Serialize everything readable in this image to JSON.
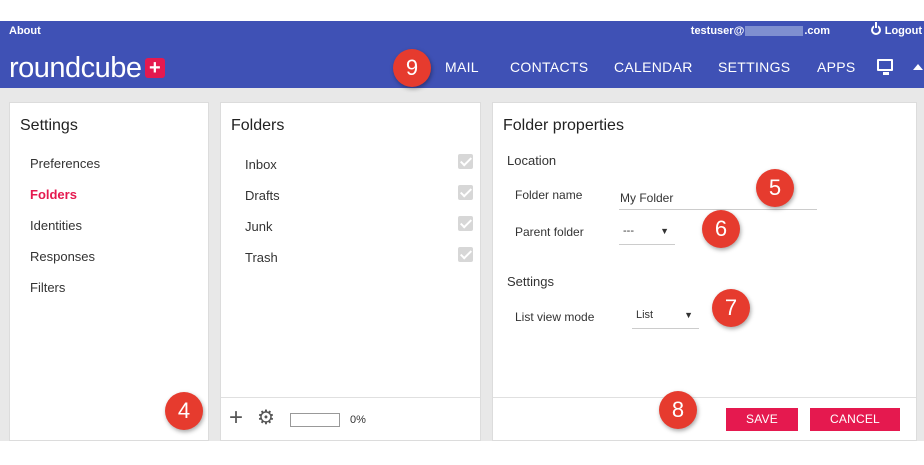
{
  "header": {
    "about": "About",
    "user_prefix": "testuser@",
    "user_suffix": ".com",
    "logout": "Logout",
    "logo": "roundcube",
    "logo_plus": "+",
    "nav": {
      "mail": "MAIL",
      "contacts": "CONTACTS",
      "calendar": "CALENDAR",
      "settings": "SETTINGS",
      "apps": "APPS"
    },
    "icons": {
      "display": "monitor-icon",
      "collapse": "caret-up-icon"
    },
    "brand_color": "#3f51b5",
    "accent_color": "#e5194f"
  },
  "settings_panel": {
    "title": "Settings",
    "items": [
      "Preferences",
      "Folders",
      "Identities",
      "Responses",
      "Filters"
    ],
    "active": "Folders"
  },
  "folders_panel": {
    "title": "Folders",
    "items": [
      {
        "label": "Inbox",
        "subscribed": true
      },
      {
        "label": "Drafts",
        "subscribed": true
      },
      {
        "label": "Junk",
        "subscribed": true
      },
      {
        "label": "Trash",
        "subscribed": true
      }
    ],
    "footer": {
      "add_icon": "plus-icon",
      "options_icon": "gear-icon",
      "quota_text": "0%",
      "quota_fraction": 0
    }
  },
  "properties_panel": {
    "title": "Folder properties",
    "location_label": "Location",
    "folder_name_label": "Folder name",
    "folder_name_value": "My Folder",
    "parent_folder_label": "Parent folder",
    "parent_folder_value": "---",
    "settings_label": "Settings",
    "list_view_mode_label": "List view mode",
    "list_view_mode_value": "List",
    "save_label": "SAVE",
    "cancel_label": "CANCEL"
  },
  "callouts": {
    "c4": "4",
    "c5": "5",
    "c6": "6",
    "c7": "7",
    "c8": "8",
    "c9": "9"
  }
}
